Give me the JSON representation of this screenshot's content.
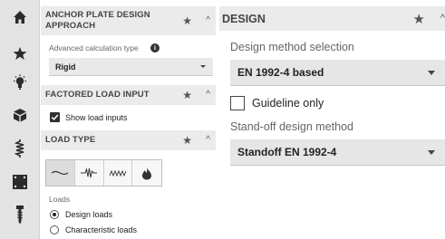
{
  "rail": {
    "items": [
      {
        "icon": "home-icon"
      },
      {
        "icon": "star-icon"
      },
      {
        "icon": "lightbulb-icon"
      },
      {
        "icon": "cube-icon"
      },
      {
        "icon": "spring-icon"
      },
      {
        "icon": "plate-icon"
      },
      {
        "icon": "anchor-bolt-icon"
      }
    ]
  },
  "anchor_plate": {
    "title": "ANCHOR PLATE DESIGN APPROACH",
    "calc_type_label": "Advanced calculation type",
    "calc_type_value": "Rigid"
  },
  "factored": {
    "title": "FACTORED LOAD INPUT",
    "show_load_inputs": "Show load inputs",
    "show_load_inputs_checked": true
  },
  "load_type": {
    "title": "LOAD TYPE",
    "options": [
      "static-load-icon",
      "seismic-load-icon",
      "fatigue-load-icon",
      "fire-load-icon"
    ],
    "loads_label": "Loads",
    "radio_design": "Design loads",
    "radio_characteristic": "Characteristic loads",
    "selected": "Design loads"
  },
  "design": {
    "title": "DESIGN",
    "method_label": "Design method selection",
    "method_value": "EN 1992-4 based",
    "guideline_label": "Guideline only",
    "guideline_checked": false,
    "standoff_label": "Stand-off design method",
    "standoff_value": "Standoff EN 1992-4"
  }
}
